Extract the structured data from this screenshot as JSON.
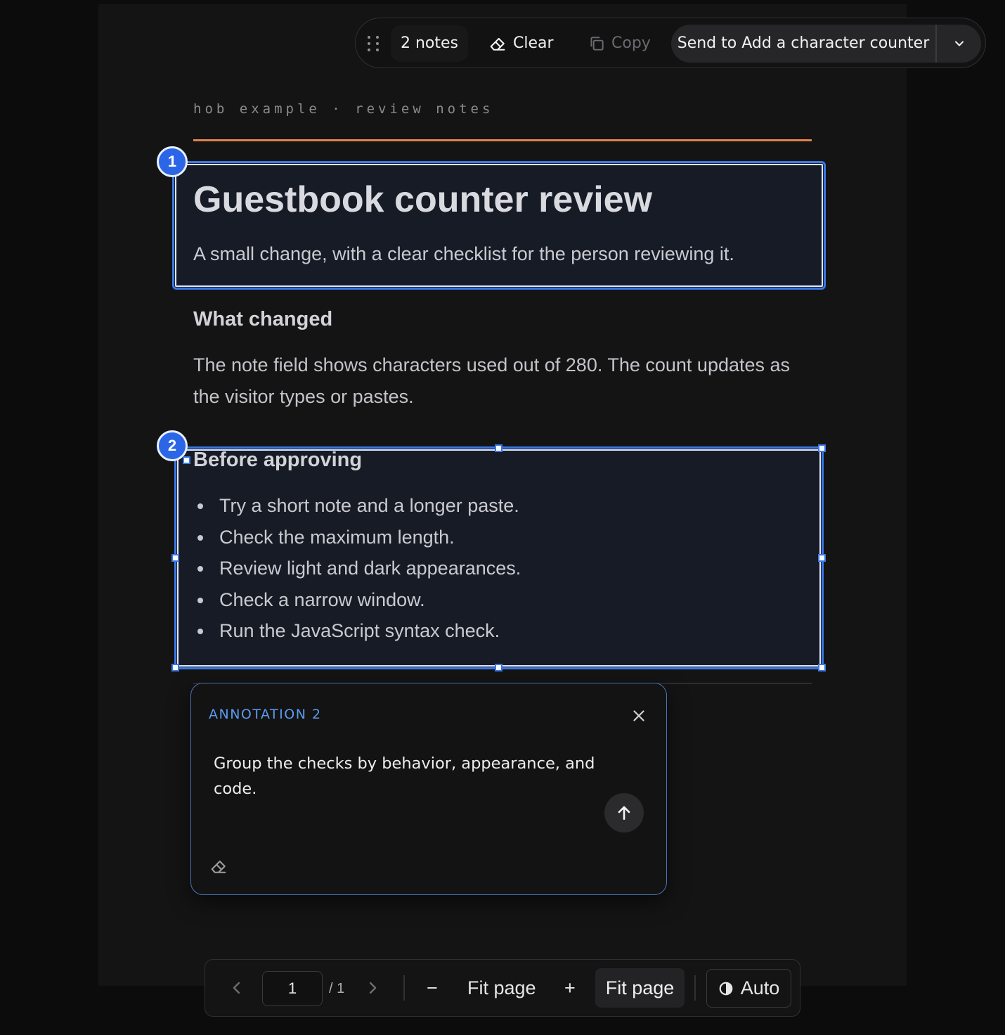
{
  "toolbar": {
    "notes_label": "2 notes",
    "clear_label": "Clear",
    "copy_label": "Copy",
    "send_label": "Send to Add a character counter",
    "icons": {
      "grip": "drag-grip-icon",
      "clear": "eraser-icon",
      "copy": "copy-icon",
      "menu": "chevron-down-icon"
    }
  },
  "document": {
    "eyebrow": "hob example · review notes",
    "title": "Guestbook counter review",
    "subtitle": "A small change, with a clear checklist for the person reviewing it.",
    "section1": {
      "heading": "What changed",
      "body": "The note field shows characters used out of 280. The count updates as the visitor types or pastes."
    },
    "section2": {
      "heading": "Before approving",
      "items": [
        "Try a short note and a longer paste.",
        "Check the maximum length.",
        "Review light and dark appearances.",
        "Check a narrow window.",
        "Run the JavaScript syntax check."
      ]
    },
    "annotation_badges": [
      "1",
      "2"
    ]
  },
  "annotation_popover": {
    "title": "ANNOTATION 2",
    "text": "Group the checks by behavior, appearance, and code.",
    "icons": {
      "close": "close-icon",
      "send": "arrow-up-icon",
      "clear": "eraser-icon"
    }
  },
  "bottom_bar": {
    "page_value": "1",
    "page_total": "/ 1",
    "zoom_out": "−",
    "zoom_label": "Fit page",
    "zoom_in": "+",
    "fit_button": "Fit page",
    "theme_label": "Auto",
    "icons": {
      "prev": "chevron-left-icon",
      "next": "chevron-right-icon",
      "theme": "contrast-icon"
    }
  },
  "colors": {
    "accent_rule": "#e0824a",
    "selection": "#3b78e6",
    "annotation_title": "#5b9bf0",
    "background": "#141414"
  }
}
